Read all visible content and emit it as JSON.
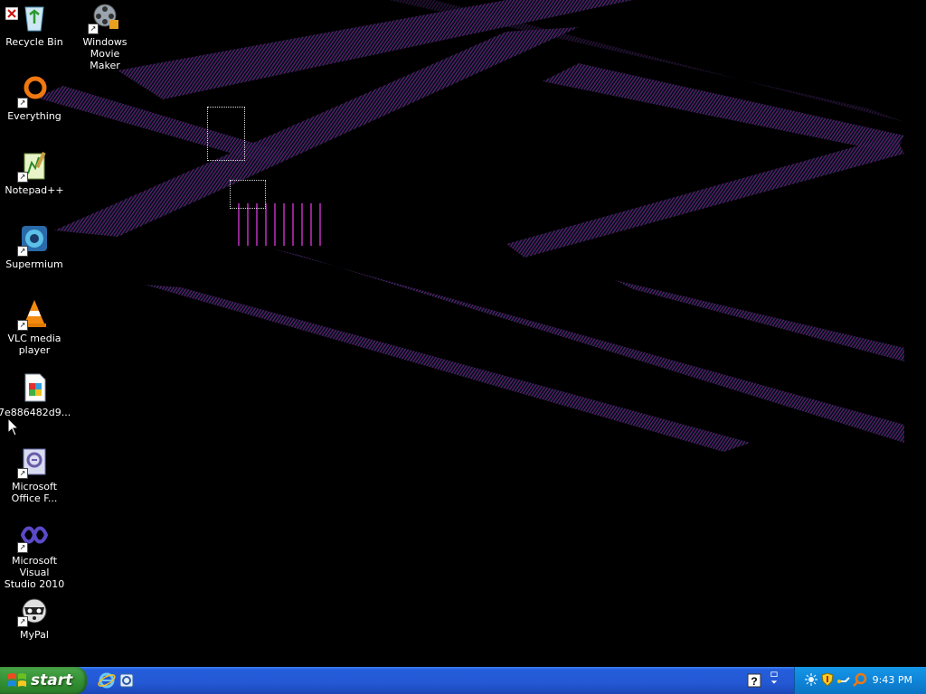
{
  "desktop": {
    "icons": [
      {
        "label": "Recycle Bin"
      },
      {
        "label": "Windows Movie\nMaker"
      },
      {
        "label": "Everything"
      },
      {
        "label": "Notepad++"
      },
      {
        "label": "Supermium"
      },
      {
        "label": "VLC media\nplayer"
      },
      {
        "label": "7e886482d9..."
      },
      {
        "label": "Microsoft\nOffice F..."
      },
      {
        "label": "Microsoft Visual\nStudio 2010"
      },
      {
        "label": "MyPal"
      }
    ]
  },
  "taskbar": {
    "start_label": "start",
    "quick_launch": [
      "internet-explorer-icon",
      "windows-explorer-icon"
    ],
    "tray_left": [
      "help-icon",
      "tray-arrows-icon"
    ],
    "tray_icons": [
      "network-icon",
      "security-shield-icon",
      "keyboard-icon",
      "search-icon"
    ],
    "clock": "9:43 PM"
  },
  "colors": {
    "desktop_bg": "#000000",
    "wallpaper_accent": "#7a1f7a",
    "taskbar_blue": "#245edb",
    "start_green": "#3c9a3c",
    "tray_blue": "#0f85d8"
  }
}
